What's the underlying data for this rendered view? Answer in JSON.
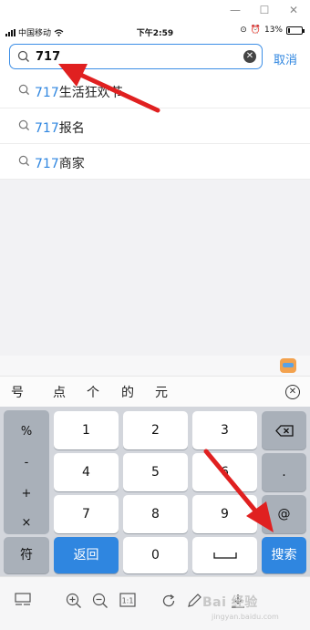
{
  "status": {
    "carrier": "中国移动",
    "time": "下午2:59",
    "battery": "13%",
    "battery_level": 0.13
  },
  "search": {
    "value": "717",
    "cancel_label": "取消"
  },
  "suggestions": [
    {
      "highlight": "717",
      "rest": "生活狂欢节"
    },
    {
      "highlight": "717",
      "rest": "报名"
    },
    {
      "highlight": "717",
      "rest": "商家"
    }
  ],
  "candidates": [
    "号",
    "点",
    "个",
    "的",
    "元"
  ],
  "keyboard": {
    "symbols": [
      "%",
      "-",
      "+",
      "×"
    ],
    "digits": [
      "1",
      "2",
      "3",
      "4",
      "5",
      "6",
      "7",
      "8",
      "9",
      "0"
    ],
    "dot": ".",
    "at": "@",
    "fu": "符",
    "back": "返回",
    "search": "搜索"
  },
  "watermark": "Bai 经验",
  "watermark_sub": "jingyan.baidu.com",
  "colors": {
    "accent": "#2f86e0",
    "arrow": "#e02020"
  }
}
